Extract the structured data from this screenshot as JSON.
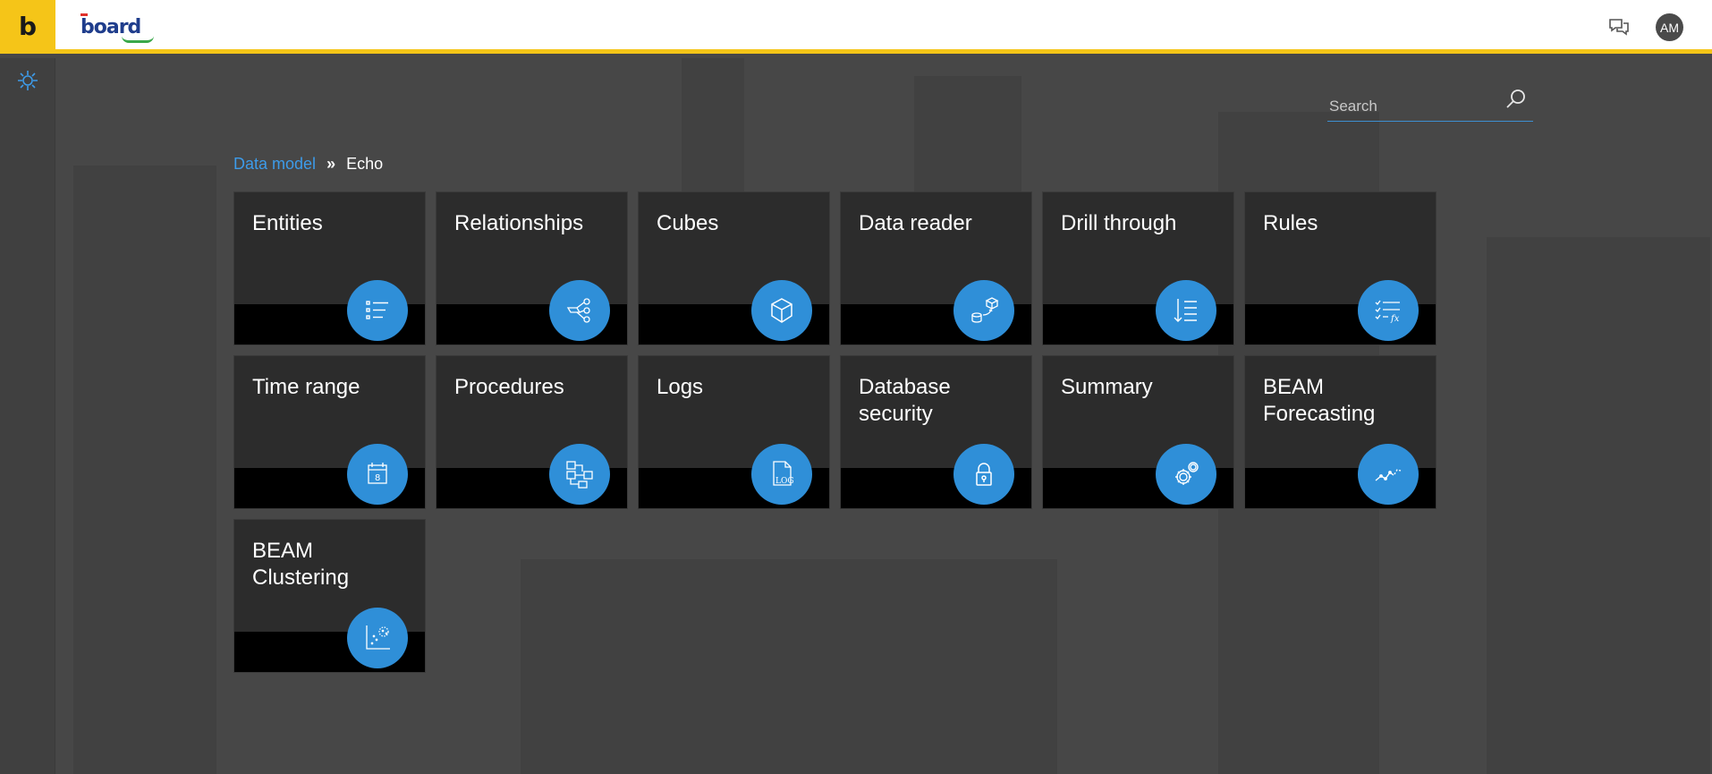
{
  "app": {
    "logo_letter": "b",
    "brand_name": "board",
    "avatar_initials": "AM",
    "accent_color": "#f5c518",
    "link_color": "#3d9be9",
    "tile_icon_color": "#2f8fd8"
  },
  "search": {
    "placeholder": "Search",
    "value": ""
  },
  "breadcrumb": {
    "parent": "Data model",
    "separator": "»",
    "current": "Echo"
  },
  "tiles": [
    {
      "label": "Entities",
      "icon": "list-icon"
    },
    {
      "label": "Relationships",
      "icon": "hierarchy-icon"
    },
    {
      "label": "Cubes",
      "icon": "cube-icon"
    },
    {
      "label": "Data reader",
      "icon": "database-transfer-icon"
    },
    {
      "label": "Drill through",
      "icon": "drill-down-icon"
    },
    {
      "label": "Rules",
      "icon": "rules-fx-icon"
    },
    {
      "label": "Time range",
      "icon": "calendar-icon"
    },
    {
      "label": "Procedures",
      "icon": "flowchart-icon"
    },
    {
      "label": "Logs",
      "icon": "log-file-icon"
    },
    {
      "label": "Database security",
      "icon": "padlock-icon"
    },
    {
      "label": "Summary",
      "icon": "gears-icon"
    },
    {
      "label": "BEAM Forecasting",
      "icon": "trend-line-icon"
    },
    {
      "label": "BEAM Clustering",
      "icon": "scatter-cluster-icon"
    }
  ],
  "tile_log_text": "LOG",
  "tile_fx_text": "fx",
  "tile_calendar_text": "8"
}
